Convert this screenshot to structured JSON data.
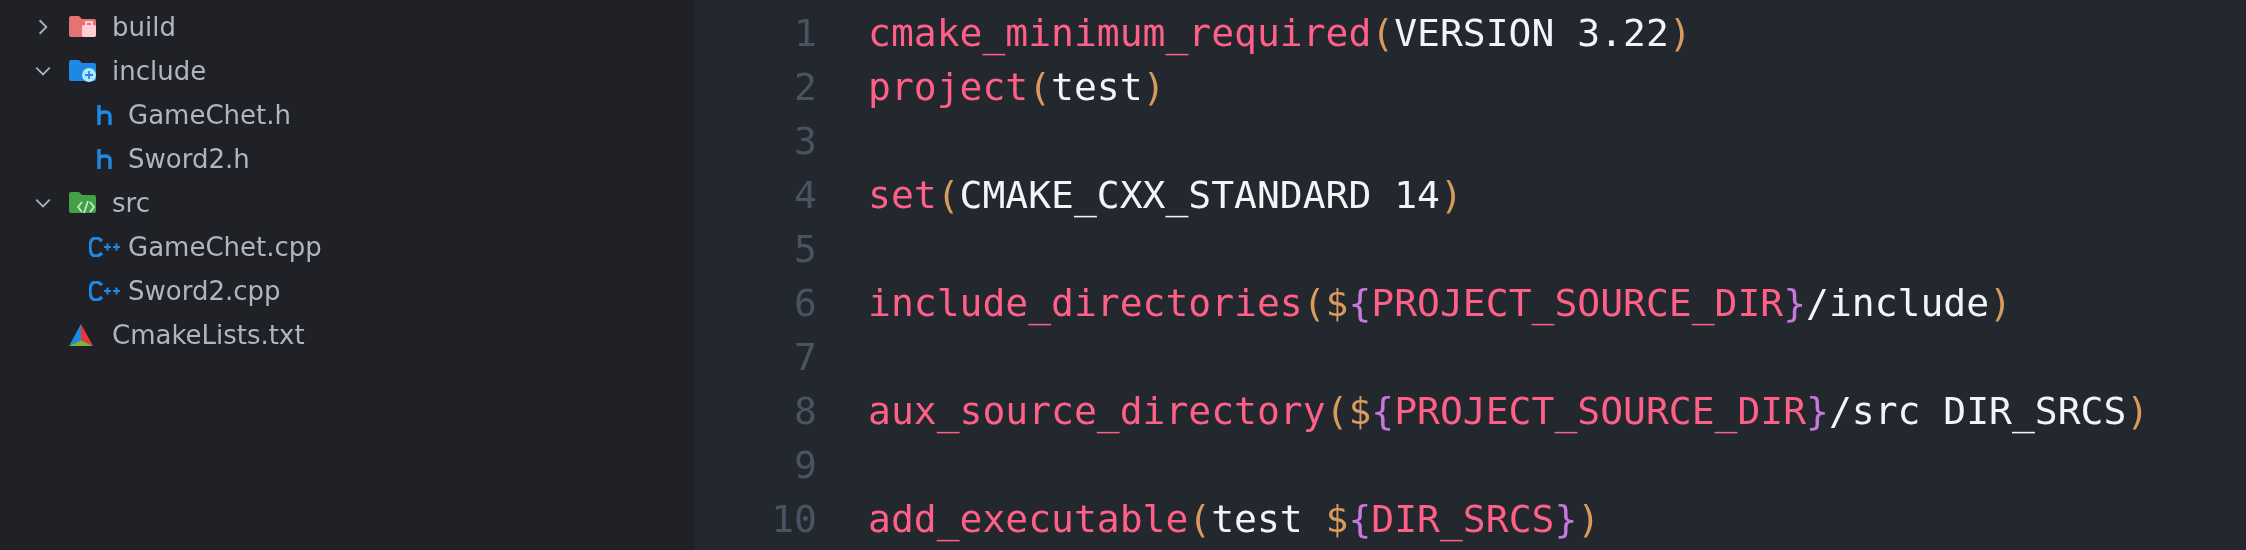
{
  "explorer": {
    "items": [
      {
        "label": "build",
        "kind": "build",
        "expanded": false
      },
      {
        "label": "include",
        "kind": "include",
        "expanded": true,
        "children": [
          {
            "label": "GameChet.h",
            "kind": "header"
          },
          {
            "label": "Sword2.h",
            "kind": "header"
          }
        ]
      },
      {
        "label": "src",
        "kind": "source",
        "expanded": true,
        "children": [
          {
            "label": "GameChet.cpp",
            "kind": "cpp"
          },
          {
            "label": "Sword2.cpp",
            "kind": "cpp"
          }
        ]
      },
      {
        "label": "CmakeLists.txt",
        "kind": "cmake"
      }
    ]
  },
  "editor": {
    "lines": [
      {
        "number": "1",
        "tokens": [
          {
            "kind": "fn",
            "text": "cmake_minimum_required"
          },
          {
            "kind": "paren",
            "text": "("
          },
          {
            "kind": "plain",
            "text": "VERSION 3.22"
          },
          {
            "kind": "paren",
            "text": ")"
          }
        ]
      },
      {
        "number": "2",
        "tokens": [
          {
            "kind": "fn",
            "text": "project"
          },
          {
            "kind": "paren",
            "text": "("
          },
          {
            "kind": "plain",
            "text": "test"
          },
          {
            "kind": "paren",
            "text": ")"
          }
        ]
      },
      {
        "number": "3"
      },
      {
        "number": "4",
        "tokens": [
          {
            "kind": "fn",
            "text": "set"
          },
          {
            "kind": "paren",
            "text": "("
          },
          {
            "kind": "plain",
            "text": "CMAKE_CXX_STANDARD 14"
          },
          {
            "kind": "paren",
            "text": ")"
          }
        ]
      },
      {
        "number": "5"
      },
      {
        "number": "6",
        "tokens": [
          {
            "kind": "fn",
            "text": "include_directories"
          },
          {
            "kind": "paren",
            "text": "("
          },
          {
            "kind": "paren",
            "text": "$"
          },
          {
            "kind": "brace",
            "text": "{"
          },
          {
            "kind": "fn",
            "text": "PROJECT_SOURCE_DIR"
          },
          {
            "kind": "brace",
            "text": "}"
          },
          {
            "kind": "plain",
            "text": "/include"
          },
          {
            "kind": "paren",
            "text": ")"
          }
        ]
      },
      {
        "number": "7"
      },
      {
        "number": "8",
        "tokens": [
          {
            "kind": "fn",
            "text": "aux_source_directory"
          },
          {
            "kind": "paren",
            "text": "("
          },
          {
            "kind": "paren",
            "text": "$"
          },
          {
            "kind": "brace",
            "text": "{"
          },
          {
            "kind": "fn",
            "text": "PROJECT_SOURCE_DIR"
          },
          {
            "kind": "brace",
            "text": "}"
          },
          {
            "kind": "plain",
            "text": "/src DIR_SRCS"
          },
          {
            "kind": "paren",
            "text": ")"
          }
        ]
      },
      {
        "number": "9"
      },
      {
        "number": "10",
        "tokens": [
          {
            "kind": "fn",
            "text": "add_executable"
          },
          {
            "kind": "paren",
            "text": "("
          },
          {
            "kind": "plain",
            "text": "test "
          },
          {
            "kind": "paren",
            "text": "$"
          },
          {
            "kind": "brace",
            "text": "{"
          },
          {
            "kind": "fn",
            "text": "DIR_SRCS"
          },
          {
            "kind": "brace",
            "text": "}"
          },
          {
            "kind": "paren",
            "text": ")"
          }
        ]
      }
    ]
  }
}
